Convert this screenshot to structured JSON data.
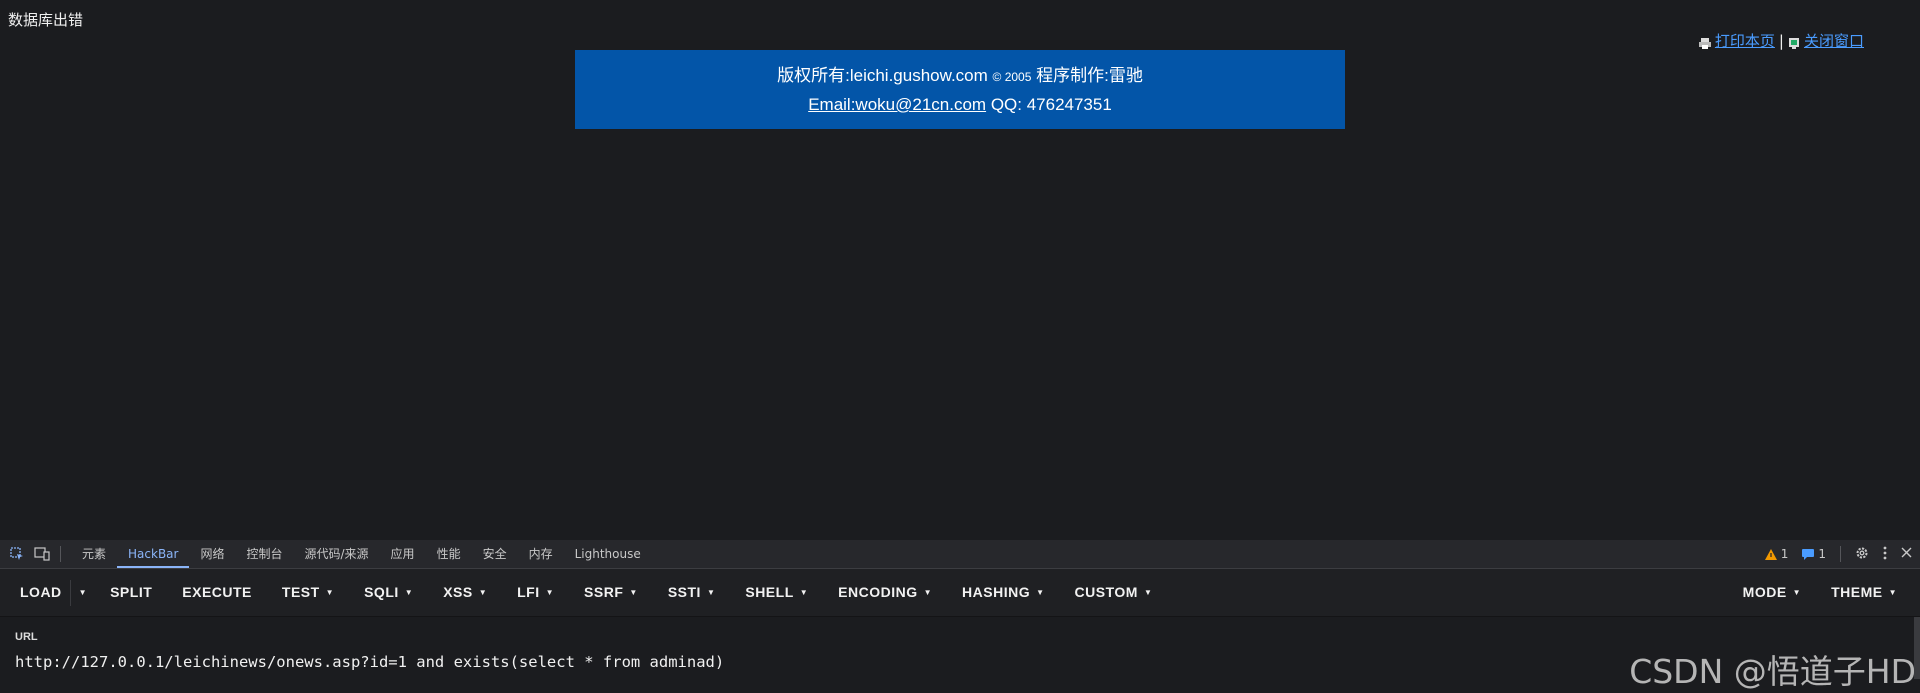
{
  "page": {
    "error_text": "数据库出错",
    "print_label": "打印本页",
    "separator": "|",
    "close_label": "关闭窗口",
    "banner": {
      "copyright_prefix": "版权所有:leichi.gushow.com",
      "copyright_year": "© 2005",
      "author": "程序制作:雷驰",
      "email": "Email:woku@21cn.com",
      "qq": "QQ: 476247351"
    }
  },
  "devtools": {
    "tabs": [
      "元素",
      "HackBar",
      "网络",
      "控制台",
      "源代码/来源",
      "应用",
      "性能",
      "安全",
      "内存",
      "Lighthouse"
    ],
    "active_tab": "HackBar",
    "warnings_count": "1",
    "messages_count": "1"
  },
  "hackbar": {
    "load": "LOAD",
    "split": "SPLIT",
    "execute": "EXECUTE",
    "test": "TEST",
    "sqli": "SQLI",
    "xss": "XSS",
    "lfi": "LFI",
    "ssrf": "SSRF",
    "ssti": "SSTI",
    "shell": "SHELL",
    "encoding": "ENCODING",
    "hashing": "HASHING",
    "custom": "CUSTOM",
    "mode": "MODE",
    "theme": "THEME",
    "url_label": "URL",
    "url_value": "http://127.0.0.1/leichinews/onews.asp?id=1 and exists(select * from adminad)"
  },
  "watermark": "CSDN @悟道子HD",
  "colors": {
    "banner_bg": "#0355a8",
    "link": "#4a9cff",
    "active_tab": "#8ab4f8",
    "warning": "#f29900",
    "info": "#4a9cff"
  }
}
